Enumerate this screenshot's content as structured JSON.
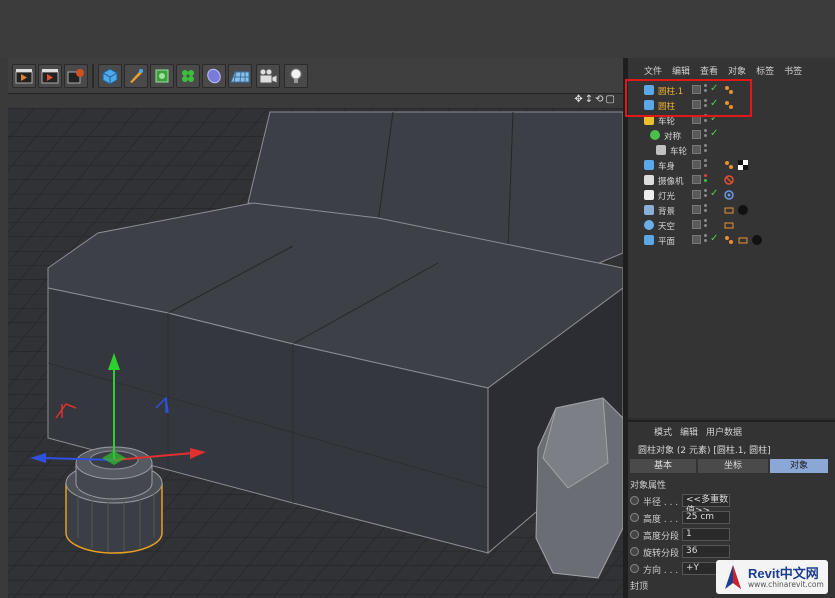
{
  "toolbar": {
    "buttons": [
      "render-view-icon",
      "render-picture-viewer-icon",
      "render-settings-icon",
      "cube-icon",
      "pen-icon",
      "subdivision-icon",
      "array-icon",
      "deformer-icon",
      "floor-icon",
      "camera-icon",
      "light-icon"
    ]
  },
  "object_manager": {
    "menu": [
      "文件",
      "编辑",
      "查看",
      "对象",
      "标签",
      "书签"
    ],
    "rows": [
      {
        "name": "圆柱.1",
        "selected": true
      },
      {
        "name": "圆柱",
        "selected": true
      },
      {
        "name": "车轮",
        "selected": false
      },
      {
        "name": "对称",
        "selected": false
      },
      {
        "name": "车轮",
        "selected": false
      },
      {
        "name": "车身",
        "selected": false
      },
      {
        "name": "摄像机",
        "selected": false
      },
      {
        "name": "灯光",
        "selected": false
      },
      {
        "name": "背景",
        "selected": false
      },
      {
        "name": "天空",
        "selected": false
      },
      {
        "name": "平面",
        "selected": false
      }
    ],
    "highlight_color": "#e01818"
  },
  "attributes": {
    "menu": [
      "模式",
      "编辑",
      "用户数据"
    ],
    "title": "圆柱对象 (2 元素) [圆柱.1, 圆柱]",
    "tabs": [
      "基本",
      "坐标",
      "对象"
    ],
    "active_tab": "对象",
    "section": "对象属性",
    "props": [
      {
        "label": "半径 . . .",
        "value": "<<多重数值>>"
      },
      {
        "label": "高度 . . .",
        "value": "25 cm"
      },
      {
        "label": "高度分段",
        "value": "1"
      },
      {
        "label": "旋转分段",
        "value": "36"
      },
      {
        "label": "方向 . . .",
        "value": "+Y"
      }
    ],
    "cap_section": "封顶"
  },
  "watermark": {
    "brand": "Revit中文网",
    "url": "www.chinarevit.com"
  }
}
